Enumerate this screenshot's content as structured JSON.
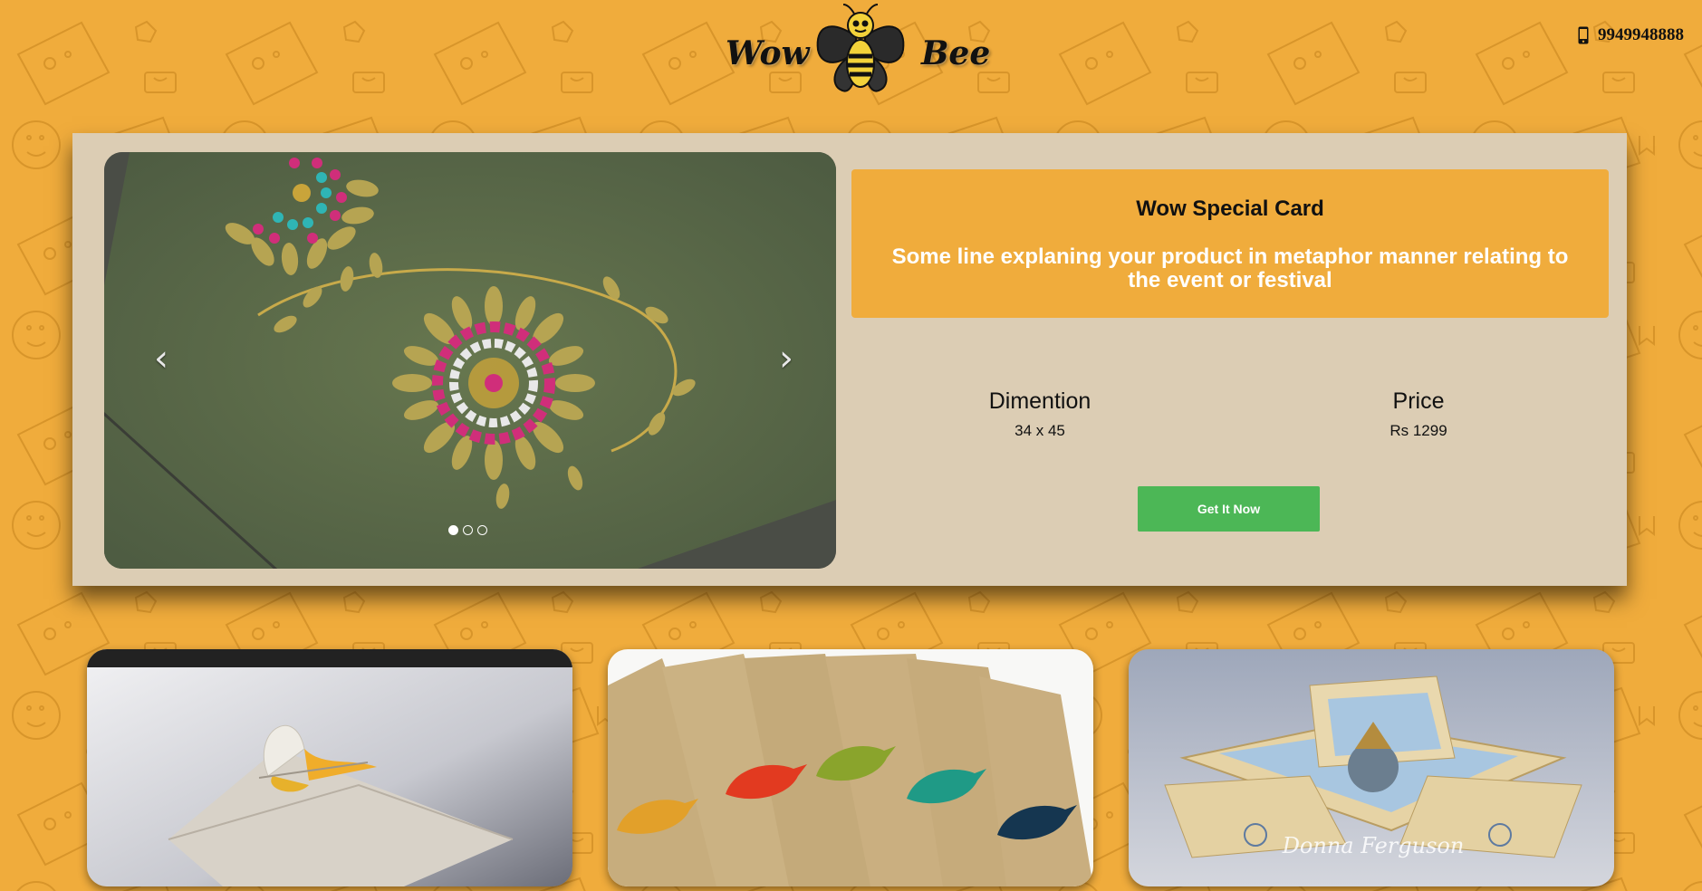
{
  "header": {
    "logo_left": "Wow",
    "logo_right": "Bee",
    "phone_icon": "mobile-phone-icon",
    "phone_number": "9949948888"
  },
  "carousel": {
    "prev_icon": "chevron-left-icon",
    "next_icon": "chevron-right-icon",
    "prev_glyph": "‹",
    "next_glyph": "›",
    "slide_count": 3,
    "active_slide": 1
  },
  "product": {
    "title": "Wow Special Card",
    "description": "Some line explaning your product in metaphor manner relating to the event or festival",
    "dimension_label": "Dimention",
    "dimension_value": "34 x 45",
    "price_label": "Price",
    "price_value": "Rs 1299",
    "button_label": "Get It Now"
  },
  "thumbnails": {
    "third_watermark": "Donna Ferguson"
  },
  "colors": {
    "background": "#f0ac3c",
    "panel": "#dccdb4",
    "button": "#4cb756"
  }
}
